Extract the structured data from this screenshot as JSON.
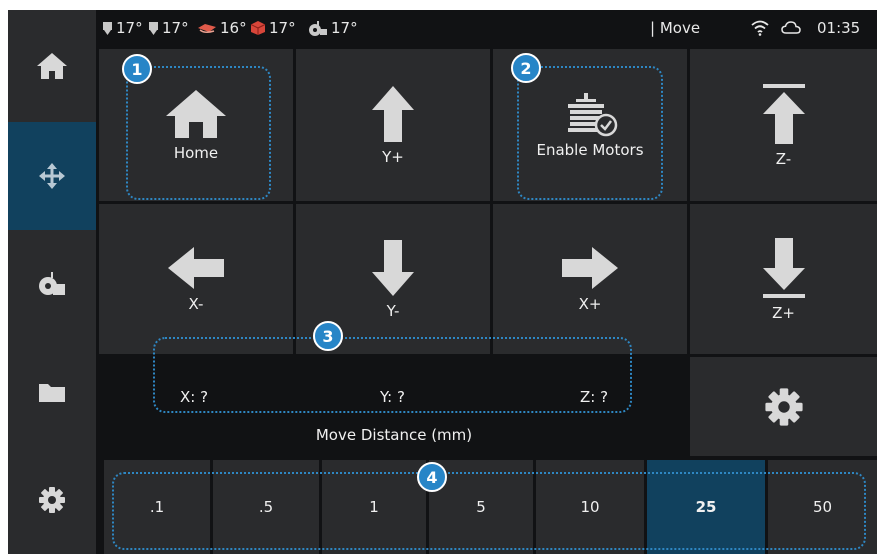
{
  "status_bar": {
    "temps": [
      {
        "icon": "nozzle-icon",
        "value": "17°"
      },
      {
        "icon": "nozzle-icon",
        "value": "17°"
      },
      {
        "icon": "bed-icon",
        "value": "16°"
      },
      {
        "icon": "chamber-icon",
        "value": "17°"
      },
      {
        "icon": "fan-icon",
        "value": "17°"
      }
    ],
    "panel_title": "| Move",
    "time": "01:35"
  },
  "sidebar": {
    "items": [
      {
        "name": "home",
        "icon": "home-icon",
        "active": false
      },
      {
        "name": "move",
        "icon": "move-arrows-icon",
        "active": true
      },
      {
        "name": "extrude",
        "icon": "extruder-icon",
        "active": false
      },
      {
        "name": "files",
        "icon": "folder-icon",
        "active": false
      },
      {
        "name": "settings",
        "icon": "gear-icon",
        "active": false
      }
    ]
  },
  "jog": {
    "home": "Home",
    "y_plus": "Y+",
    "enable_motors": "Enable Motors",
    "z_minus": "Z-",
    "x_minus": "X-",
    "y_minus": "Y-",
    "x_plus": "X+",
    "z_plus": "Z+"
  },
  "position": {
    "x": "X: ?",
    "y": "Y: ?",
    "z": "Z: ?"
  },
  "move_distance_label": "Move Distance (mm)",
  "distances": [
    ".1",
    ".5",
    "1",
    "5",
    "10",
    "25",
    "50"
  ],
  "selected_distance": "25",
  "callouts": [
    "1",
    "2",
    "3",
    "4"
  ],
  "colors": {
    "accent": "#11415e",
    "badge": "#2785c7",
    "tile": "#2a2b2d",
    "background": "#111214"
  }
}
